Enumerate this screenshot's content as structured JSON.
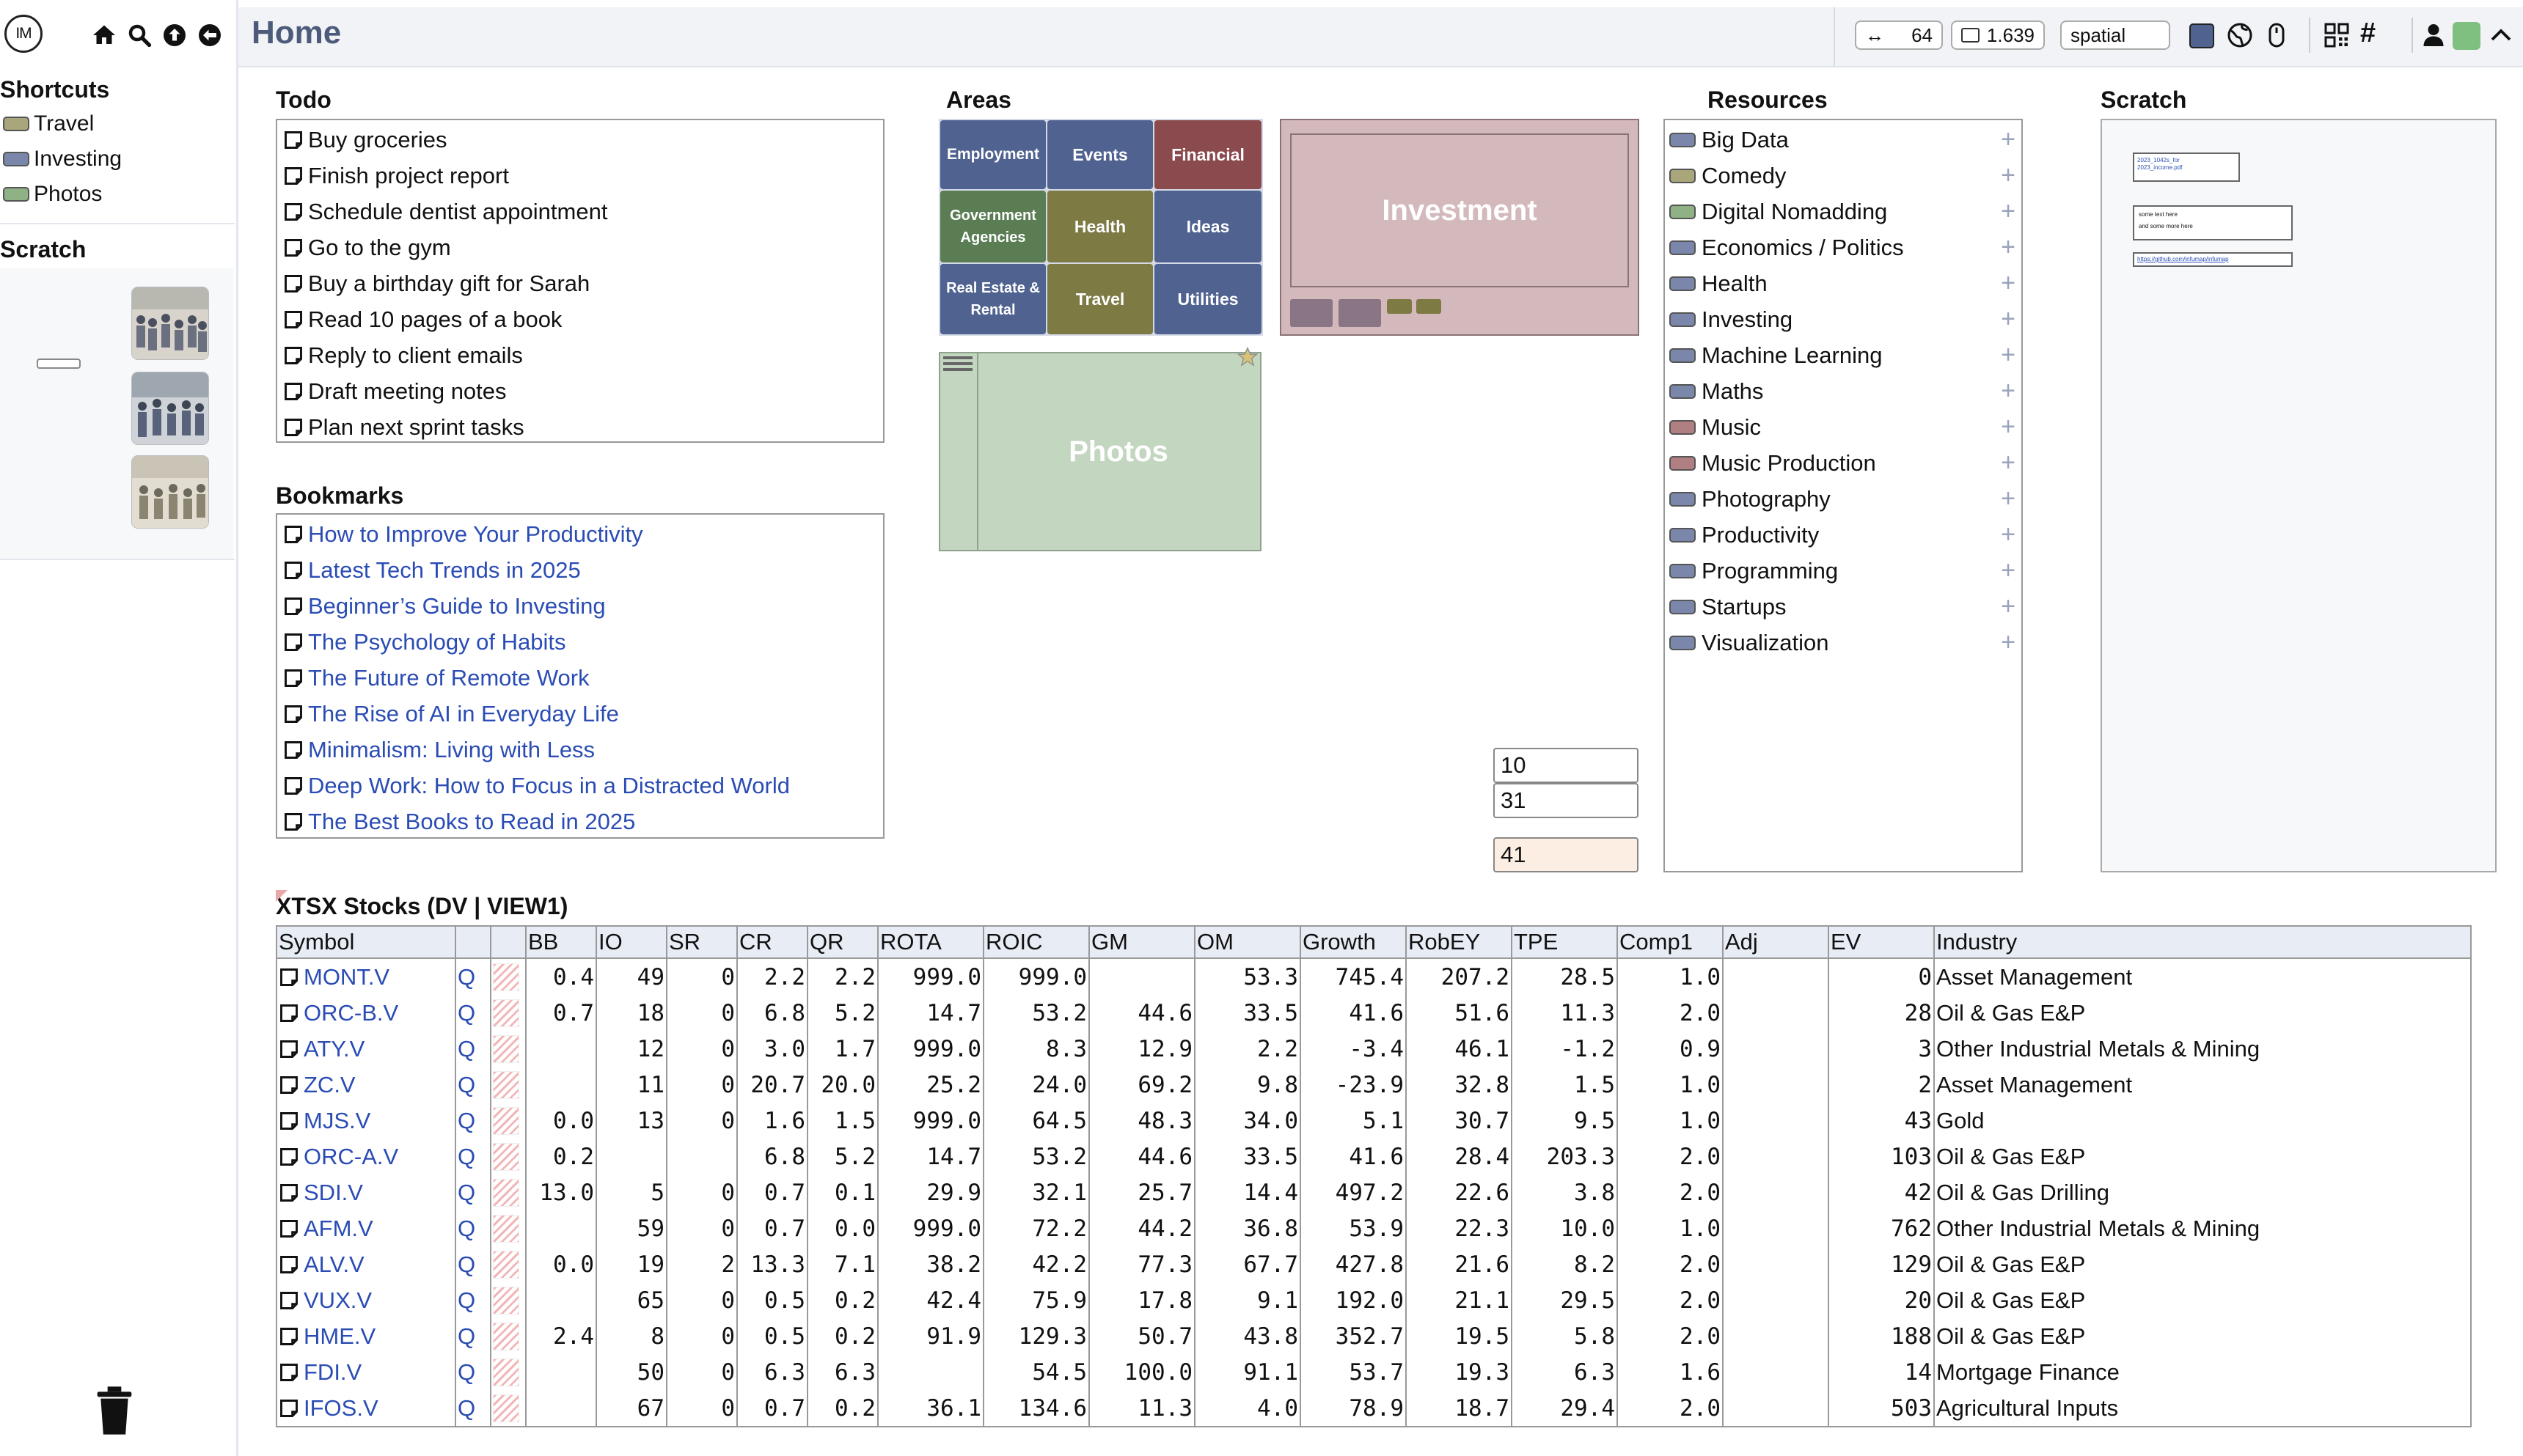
{
  "app": {
    "logo_text": "IM",
    "page_title": "Home"
  },
  "toolbar": {
    "width_value": "64",
    "ratio_value": "1.639",
    "mode_value": "spatial",
    "accent_color": "#4f6290",
    "green_color": "#7fbf7f"
  },
  "sidebar": {
    "shortcuts_title": "Shortcuts",
    "shortcuts": [
      {
        "label": "Travel",
        "color": "#a8a67a"
      },
      {
        "label": "Investing",
        "color": "#7a87aa"
      },
      {
        "label": "Photos",
        "color": "#8fb186"
      }
    ],
    "scratch_title": "Scratch"
  },
  "todo": {
    "title": "Todo",
    "items": [
      "Buy groceries",
      "Finish project report",
      "Schedule dentist appointment",
      "Go to the gym",
      "Buy a birthday gift for Sarah",
      "Read 10 pages of a book",
      "Reply to client emails",
      "Draft meeting notes",
      "Plan next sprint tasks"
    ]
  },
  "bookmarks": {
    "title": "Bookmarks",
    "items": [
      "How to Improve Your Productivity",
      "Latest Tech Trends in 2025",
      "Beginner’s Guide to Investing",
      "The Psychology of Habits",
      "The Future of Remote Work",
      "The Rise of AI in Everyday Life",
      "Minimalism: Living with Less",
      "Deep Work: How to Focus in a Distracted World",
      "The Best Books to Read in 2025"
    ]
  },
  "areas": {
    "title": "Areas",
    "tiles": [
      {
        "label": "Employment",
        "color": "#4f6290"
      },
      {
        "label": "Events",
        "color": "#4f6290"
      },
      {
        "label": "Financial",
        "color": "#8a4a4e"
      },
      {
        "label": "Government Agencies",
        "color": "#5a7d54"
      },
      {
        "label": "Health",
        "color": "#7d7a44"
      },
      {
        "label": "Ideas",
        "color": "#4f6290"
      },
      {
        "label": "Real Estate & Rental",
        "color": "#4f6290"
      },
      {
        "label": "Travel",
        "color": "#7d7a44"
      },
      {
        "label": "Utilities",
        "color": "#4f6290"
      }
    ],
    "investment_label": "Investment",
    "photos_label": "Photos"
  },
  "number_inputs": {
    "a": "10",
    "b": "31",
    "sum": "41"
  },
  "resources": {
    "title": "Resources",
    "items": [
      {
        "label": "Big Data",
        "color": "#7a87aa"
      },
      {
        "label": "Comedy",
        "color": "#a8a67a"
      },
      {
        "label": "Digital Nomadding",
        "color": "#8fb186"
      },
      {
        "label": "Economics / Politics",
        "color": "#7a87aa"
      },
      {
        "label": "Health",
        "color": "#7a87aa"
      },
      {
        "label": "Investing",
        "color": "#7a87aa"
      },
      {
        "label": "Machine Learning",
        "color": "#7a87aa"
      },
      {
        "label": "Maths",
        "color": "#7a87aa"
      },
      {
        "label": "Music",
        "color": "#b07f82"
      },
      {
        "label": "Music Production",
        "color": "#b07f82"
      },
      {
        "label": "Photography",
        "color": "#7a87aa"
      },
      {
        "label": "Productivity",
        "color": "#7a87aa"
      },
      {
        "label": "Programming",
        "color": "#7a87aa"
      },
      {
        "label": "Startups",
        "color": "#7a87aa"
      },
      {
        "label": "Visualization",
        "color": "#7a87aa"
      }
    ]
  },
  "scratch": {
    "title": "Scratch",
    "file_text_1": "2023_1042s_for",
    "file_text_2": "2023_income.pdf",
    "note_line_1": "some text here",
    "note_line_2": "and some more here",
    "link_text": "https://github.com/infumap/infumap"
  },
  "stocks": {
    "title": "XTSX Stocks (DV | VIEW1)",
    "columns": [
      "Symbol",
      "",
      "",
      "BB",
      "IO",
      "SR",
      "CR",
      "QR",
      "ROTA",
      "ROIC",
      "GM",
      "OM",
      "Growth",
      "RobEY",
      "TPE",
      "Comp1",
      "Adj",
      "EV",
      "Industry"
    ],
    "q_label": "Q",
    "rows": [
      [
        "MONT.V",
        "0.4",
        "49",
        "0",
        "2.2",
        "2.2",
        "999.0",
        "999.0",
        "",
        "53.3",
        "745.4",
        "207.2",
        "28.5",
        "1.0",
        "",
        "0",
        "Asset Management"
      ],
      [
        "ORC-B.V",
        "0.7",
        "18",
        "0",
        "6.8",
        "5.2",
        "14.7",
        "53.2",
        "44.6",
        "33.5",
        "41.6",
        "51.6",
        "11.3",
        "2.0",
        "",
        "28",
        "Oil & Gas E&P"
      ],
      [
        "ATY.V",
        "",
        "12",
        "0",
        "3.0",
        "1.7",
        "999.0",
        "8.3",
        "12.9",
        "2.2",
        "-3.4",
        "46.1",
        "-1.2",
        "0.9",
        "",
        "3",
        "Other Industrial Metals & Mining"
      ],
      [
        "ZC.V",
        "",
        "11",
        "0",
        "20.7",
        "20.0",
        "25.2",
        "24.0",
        "69.2",
        "9.8",
        "-23.9",
        "32.8",
        "1.5",
        "1.0",
        "",
        "2",
        "Asset Management"
      ],
      [
        "MJS.V",
        "0.0",
        "13",
        "0",
        "1.6",
        "1.5",
        "999.0",
        "64.5",
        "48.3",
        "34.0",
        "5.1",
        "30.7",
        "9.5",
        "1.0",
        "",
        "43",
        "Gold"
      ],
      [
        "ORC-A.V",
        "0.2",
        "",
        "",
        "6.8",
        "5.2",
        "14.7",
        "53.2",
        "44.6",
        "33.5",
        "41.6",
        "28.4",
        "203.3",
        "2.0",
        "",
        "103",
        "Oil & Gas E&P"
      ],
      [
        "SDI.V",
        "13.0",
        "5",
        "0",
        "0.7",
        "0.1",
        "29.9",
        "32.1",
        "25.7",
        "14.4",
        "497.2",
        "22.6",
        "3.8",
        "2.0",
        "",
        "42",
        "Oil & Gas Drilling"
      ],
      [
        "AFM.V",
        "",
        "59",
        "0",
        "0.7",
        "0.0",
        "999.0",
        "72.2",
        "44.2",
        "36.8",
        "53.9",
        "22.3",
        "10.0",
        "1.0",
        "",
        "762",
        "Other Industrial Metals & Mining"
      ],
      [
        "ALV.V",
        "0.0",
        "19",
        "2",
        "13.3",
        "7.1",
        "38.2",
        "42.2",
        "77.3",
        "67.7",
        "427.8",
        "21.6",
        "8.2",
        "2.0",
        "",
        "129",
        "Oil & Gas E&P"
      ],
      [
        "VUX.V",
        "",
        "65",
        "0",
        "0.5",
        "0.2",
        "42.4",
        "75.9",
        "17.8",
        "9.1",
        "192.0",
        "21.1",
        "29.5",
        "2.0",
        "",
        "20",
        "Oil & Gas E&P"
      ],
      [
        "HME.V",
        "2.4",
        "8",
        "0",
        "0.5",
        "0.2",
        "91.9",
        "129.3",
        "50.7",
        "43.8",
        "352.7",
        "19.5",
        "5.8",
        "2.0",
        "",
        "188",
        "Oil & Gas E&P"
      ],
      [
        "FDI.V",
        "",
        "50",
        "0",
        "6.3",
        "6.3",
        "",
        "54.5",
        "100.0",
        "91.1",
        "53.7",
        "19.3",
        "6.3",
        "1.6",
        "",
        "14",
        "Mortgage Finance"
      ],
      [
        "IFOS.V",
        "",
        "67",
        "0",
        "0.7",
        "0.2",
        "36.1",
        "134.6",
        "11.3",
        "4.0",
        "78.9",
        "18.7",
        "29.4",
        "2.0",
        "",
        "503",
        "Agricultural Inputs"
      ]
    ]
  }
}
